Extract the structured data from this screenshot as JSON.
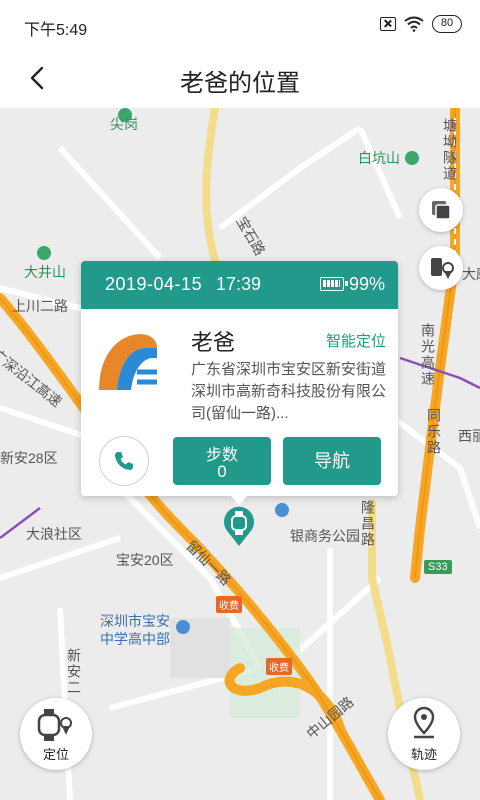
{
  "status_bar": {
    "time": "下午5:49",
    "battery": "80"
  },
  "header": {
    "title": "老爸的位置"
  },
  "map": {
    "labels": {
      "jiangang": "尖岗",
      "tangkeng_tunnel": "塘坳隧道",
      "baikengshan": "白坑山",
      "dajingshan": "大井山",
      "shangchuan_road": "上川二路",
      "guangshen_expy": "广深沿江高速",
      "xinan28": "新安28区",
      "dalang": "大浪社区",
      "baoan20": "宝安20区",
      "liuxian1": "留仙一路",
      "business_park": "银商务公园",
      "longchang_rd": "隆昌路",
      "nanguang_expy": "南光高速",
      "tongle_rd": "同乐路",
      "school": "深圳市宝安中学高中部",
      "xinan2": "新安二",
      "zhongshanyuan_rd": "中山园路",
      "toll1": "收费",
      "toll2": "收费",
      "s33": "S33",
      "xiji": "西丽",
      "dasha": "大磨",
      "baishi": "宝石路"
    },
    "locate_button": "定位",
    "track_button": "轨迹"
  },
  "card": {
    "date": "2019-04-15",
    "time": "17:39",
    "battery_percent": "99%",
    "battery_level": 0.99,
    "name": "老爸",
    "mode": "智能定位",
    "address": "广东省深圳市宝安区新安街道深圳市高新奇科技股份有限公司(留仙一路)...",
    "steps_label": "步数",
    "steps_value": "0",
    "navigate_label": "导航"
  },
  "colors": {
    "accent": "#219a8b",
    "highway": "#f6a623",
    "map_bg": "#ececec"
  }
}
